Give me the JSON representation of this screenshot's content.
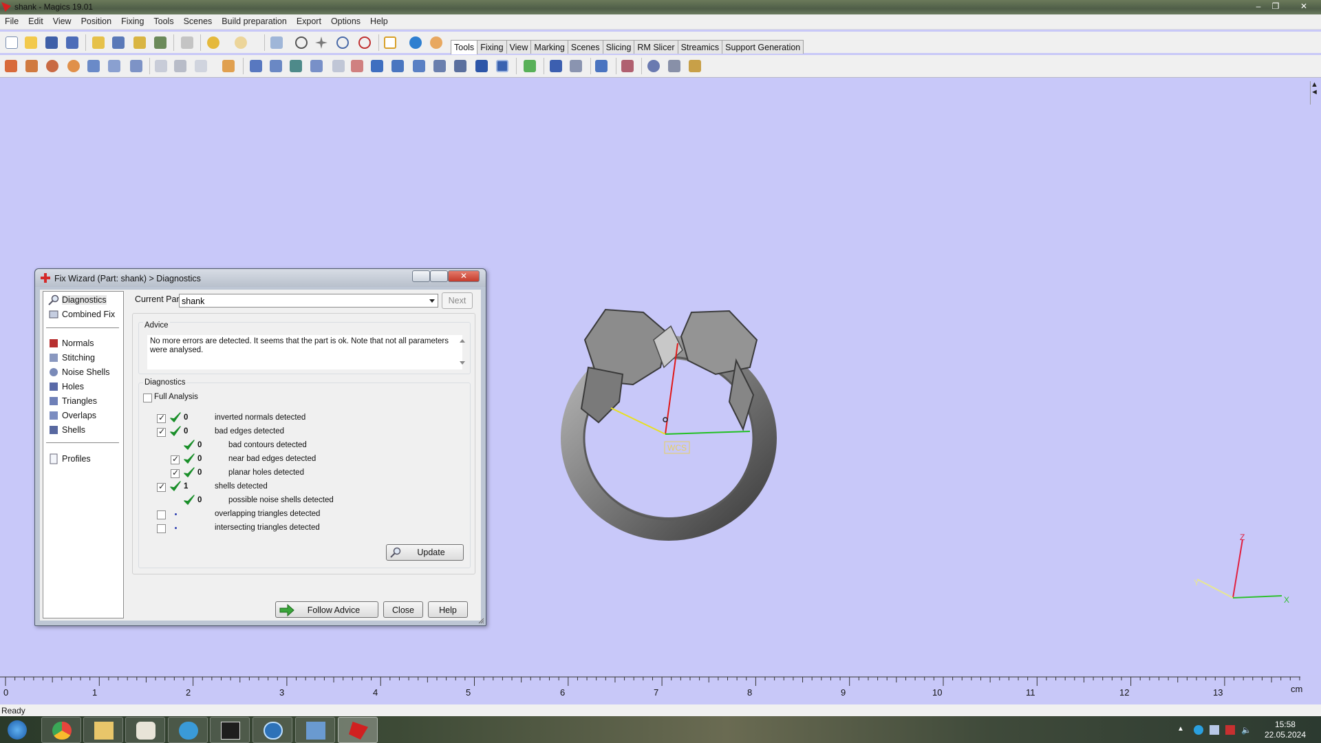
{
  "window": {
    "title": "shank - Magics 19.01",
    "controls": [
      "minimize-icon",
      "restore-icon",
      "close-icon"
    ]
  },
  "menu": [
    "File",
    "Edit",
    "View",
    "Position",
    "Fixing",
    "Tools",
    "Scenes",
    "Build preparation",
    "Export",
    "Options",
    "Help"
  ],
  "toolbar_tabs": {
    "active": "Tools",
    "items": [
      "Tools",
      "Fixing",
      "View",
      "Marking",
      "Scenes",
      "Slicing",
      "RM Slicer",
      "Streamics",
      "Support Generation"
    ]
  },
  "ruler": {
    "labels": [
      "0",
      "1",
      "2",
      "3",
      "4",
      "5",
      "6",
      "7",
      "8",
      "9",
      "10",
      "11",
      "12",
      "13"
    ],
    "unit": "cm"
  },
  "viewport": {
    "wcs_label": "WCS",
    "axis_labels": {
      "x": "X",
      "y": "Y",
      "z": "Z"
    }
  },
  "status": {
    "text": "Ready"
  },
  "taskbar": {
    "apps": [
      "start-button",
      "chrome-icon",
      "explorer-icon",
      "paint-icon",
      "vectorworks-icon",
      "inkscape-icon",
      "app-circle-icon",
      "photo-viewer-icon",
      "magics-icon"
    ],
    "time": "15:58",
    "date": "22.05.2024"
  },
  "dialog": {
    "title": "Fix Wizard (Part: shank) > Diagnostics",
    "nav": {
      "top": [
        "Diagnostics",
        "Combined Fix"
      ],
      "middle": [
        "Normals",
        "Stitching",
        "Noise Shells",
        "Holes",
        "Triangles",
        "Overlaps",
        "Shells"
      ],
      "bottom": [
        "Profiles"
      ],
      "selected": "Diagnostics"
    },
    "current_part_label": "Current Part:",
    "current_part_value": "shank",
    "next_label": "Next",
    "advice": {
      "heading": "Advice",
      "text": "No more errors are detected. It seems that the part is ok. Note that not all parameters were analysed."
    },
    "diagnostics": {
      "heading": "Diagnostics",
      "full_analysis_label": "Full Analysis",
      "full_analysis_checked": false,
      "rows": [
        {
          "checkbox": true,
          "checked": true,
          "status": "ok",
          "count": "0",
          "label": "inverted normals detected",
          "indent": 0
        },
        {
          "checkbox": true,
          "checked": true,
          "status": "ok",
          "count": "0",
          "label": "bad edges detected",
          "indent": 0
        },
        {
          "checkbox": false,
          "checked": false,
          "status": "ok",
          "count": "0",
          "label": "bad contours detected",
          "indent": 1
        },
        {
          "checkbox": true,
          "checked": true,
          "status": "ok",
          "count": "0",
          "label": "near bad edges detected",
          "indent": 1
        },
        {
          "checkbox": true,
          "checked": true,
          "status": "ok",
          "count": "0",
          "label": "planar holes detected",
          "indent": 1
        },
        {
          "checkbox": true,
          "checked": true,
          "status": "ok",
          "count": "1",
          "label": "shells detected",
          "indent": 0
        },
        {
          "checkbox": false,
          "checked": false,
          "status": "ok",
          "count": "0",
          "label": "possible noise shells detected",
          "indent": 1
        },
        {
          "checkbox": true,
          "checked": false,
          "status": "unknown",
          "count": "",
          "label": "overlapping triangles detected",
          "indent": 0
        },
        {
          "checkbox": true,
          "checked": false,
          "status": "unknown",
          "count": "",
          "label": "intersecting triangles detected",
          "indent": 0
        }
      ],
      "update_label": "Update"
    },
    "buttons": {
      "follow_advice": "Follow Advice",
      "close": "Close",
      "help": "Help"
    }
  },
  "colors": {
    "viewport_bg": "#c8c8f9",
    "check_green": "#1a8f2a",
    "dialog_frame": "#bdc6d4"
  }
}
